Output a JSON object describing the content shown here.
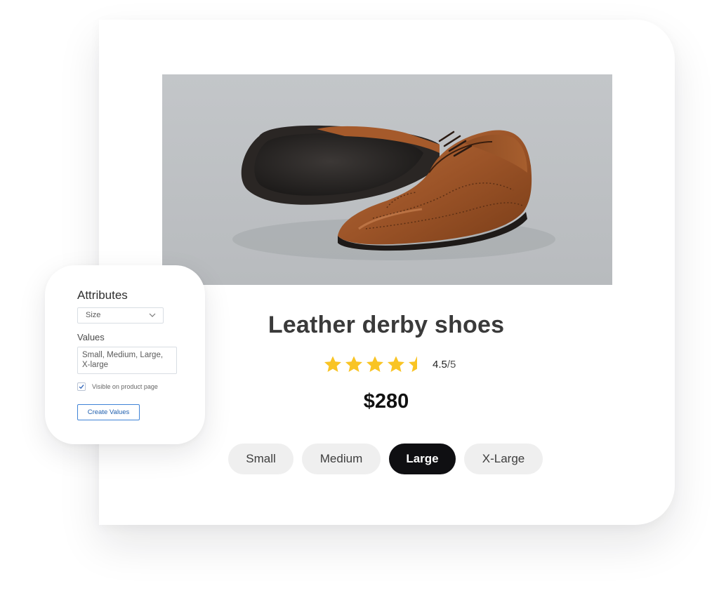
{
  "product": {
    "image_alt": "brown leather brogue shoes",
    "title": "Leather derby shoes",
    "rating": 4.5,
    "rating_value": "4.5",
    "rating_separator": "/",
    "rating_max": "5",
    "price": "$280",
    "star_color": "#f9c424",
    "sizes": [
      {
        "label": "Small",
        "selected": false
      },
      {
        "label": "Medium",
        "selected": false
      },
      {
        "label": "Large",
        "selected": true
      },
      {
        "label": "X-Large",
        "selected": false
      }
    ]
  },
  "attributes_panel": {
    "title": "Attributes",
    "attribute_select_value": "Size",
    "values_label": "Values",
    "values_text": "Small, Medium, Large, X-large",
    "visible_checked": true,
    "visible_label": "Visible on product page",
    "create_button_label": "Create Values",
    "accent_color": "#3f83d7"
  },
  "icons": {
    "star": "star-icon",
    "half_star": "half-star-icon",
    "chevron": "chevron-down-icon",
    "check": "check-icon"
  }
}
